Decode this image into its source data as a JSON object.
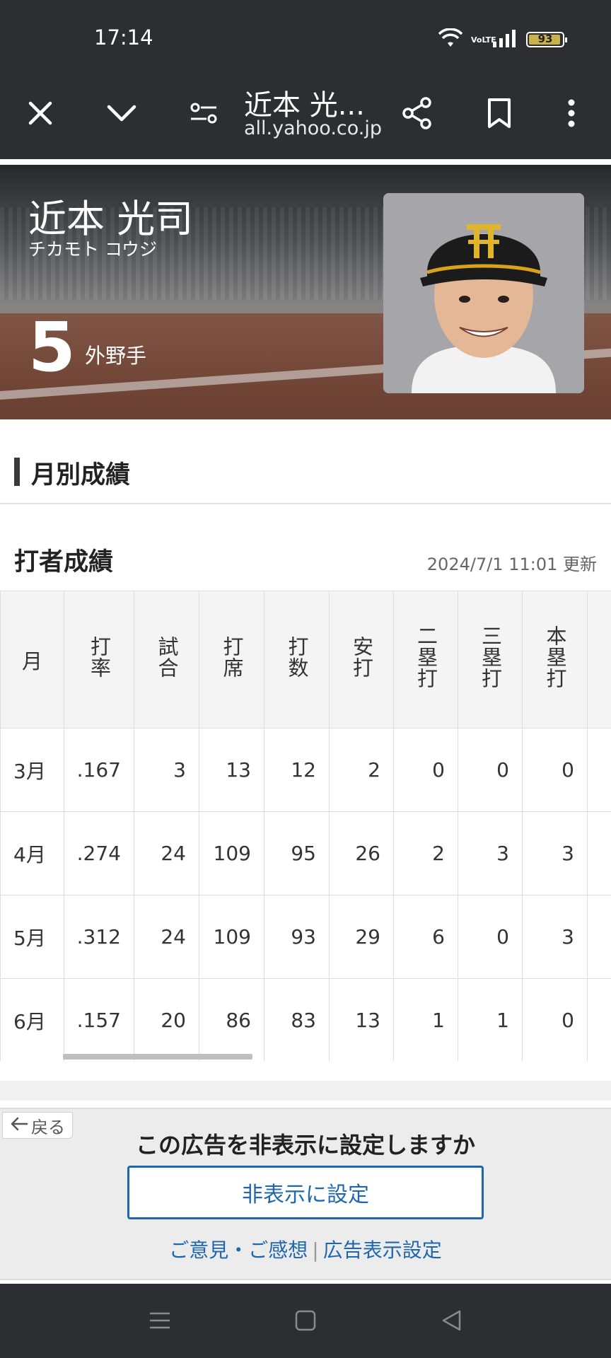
{
  "status_bar": {
    "time": "17:14",
    "battery": "93",
    "network_label": "VoLTE",
    "icons": [
      "wifi-icon",
      "volte-icon",
      "signal-icon",
      "battery-icon"
    ]
  },
  "toolbar": {
    "page_title": "近本 光...",
    "url": "all.yahoo.co.jp",
    "icons": [
      "close-icon",
      "chevron-down-icon",
      "page-settings-icon",
      "share-icon",
      "bookmark-icon",
      "more-vert-icon"
    ]
  },
  "player": {
    "name": "近本 光司",
    "kana": "チカモト コウジ",
    "number": "5",
    "position": "外野手"
  },
  "section": {
    "title": "月別成績"
  },
  "batting": {
    "title": "打者成績",
    "updated": "2024/7/1 11:01 更新",
    "columns": [
      "月",
      "打率",
      "試合",
      "打席",
      "打数",
      "安打",
      "二塁打",
      "三塁打",
      "本塁打"
    ],
    "rows": [
      [
        "3月",
        ".167",
        "3",
        "13",
        "12",
        "2",
        "0",
        "0",
        "0"
      ],
      [
        "4月",
        ".274",
        "24",
        "109",
        "95",
        "26",
        "2",
        "3",
        "3"
      ],
      [
        "5月",
        ".312",
        "24",
        "109",
        "93",
        "29",
        "6",
        "0",
        "3"
      ],
      [
        "6月",
        ".157",
        "20",
        "86",
        "83",
        "13",
        "1",
        "1",
        "0"
      ]
    ]
  },
  "ad": {
    "back_label": "戻る",
    "question": "この広告を非表示に設定しますか",
    "hide_button": "非表示に設定",
    "link_feedback": "ご意見・ご感想",
    "link_settings": "広告表示設定"
  },
  "colors": {
    "chrome_dark": "#2d2e31",
    "link_blue": "#1e67ae",
    "battery_fill": "#c9b24a"
  }
}
